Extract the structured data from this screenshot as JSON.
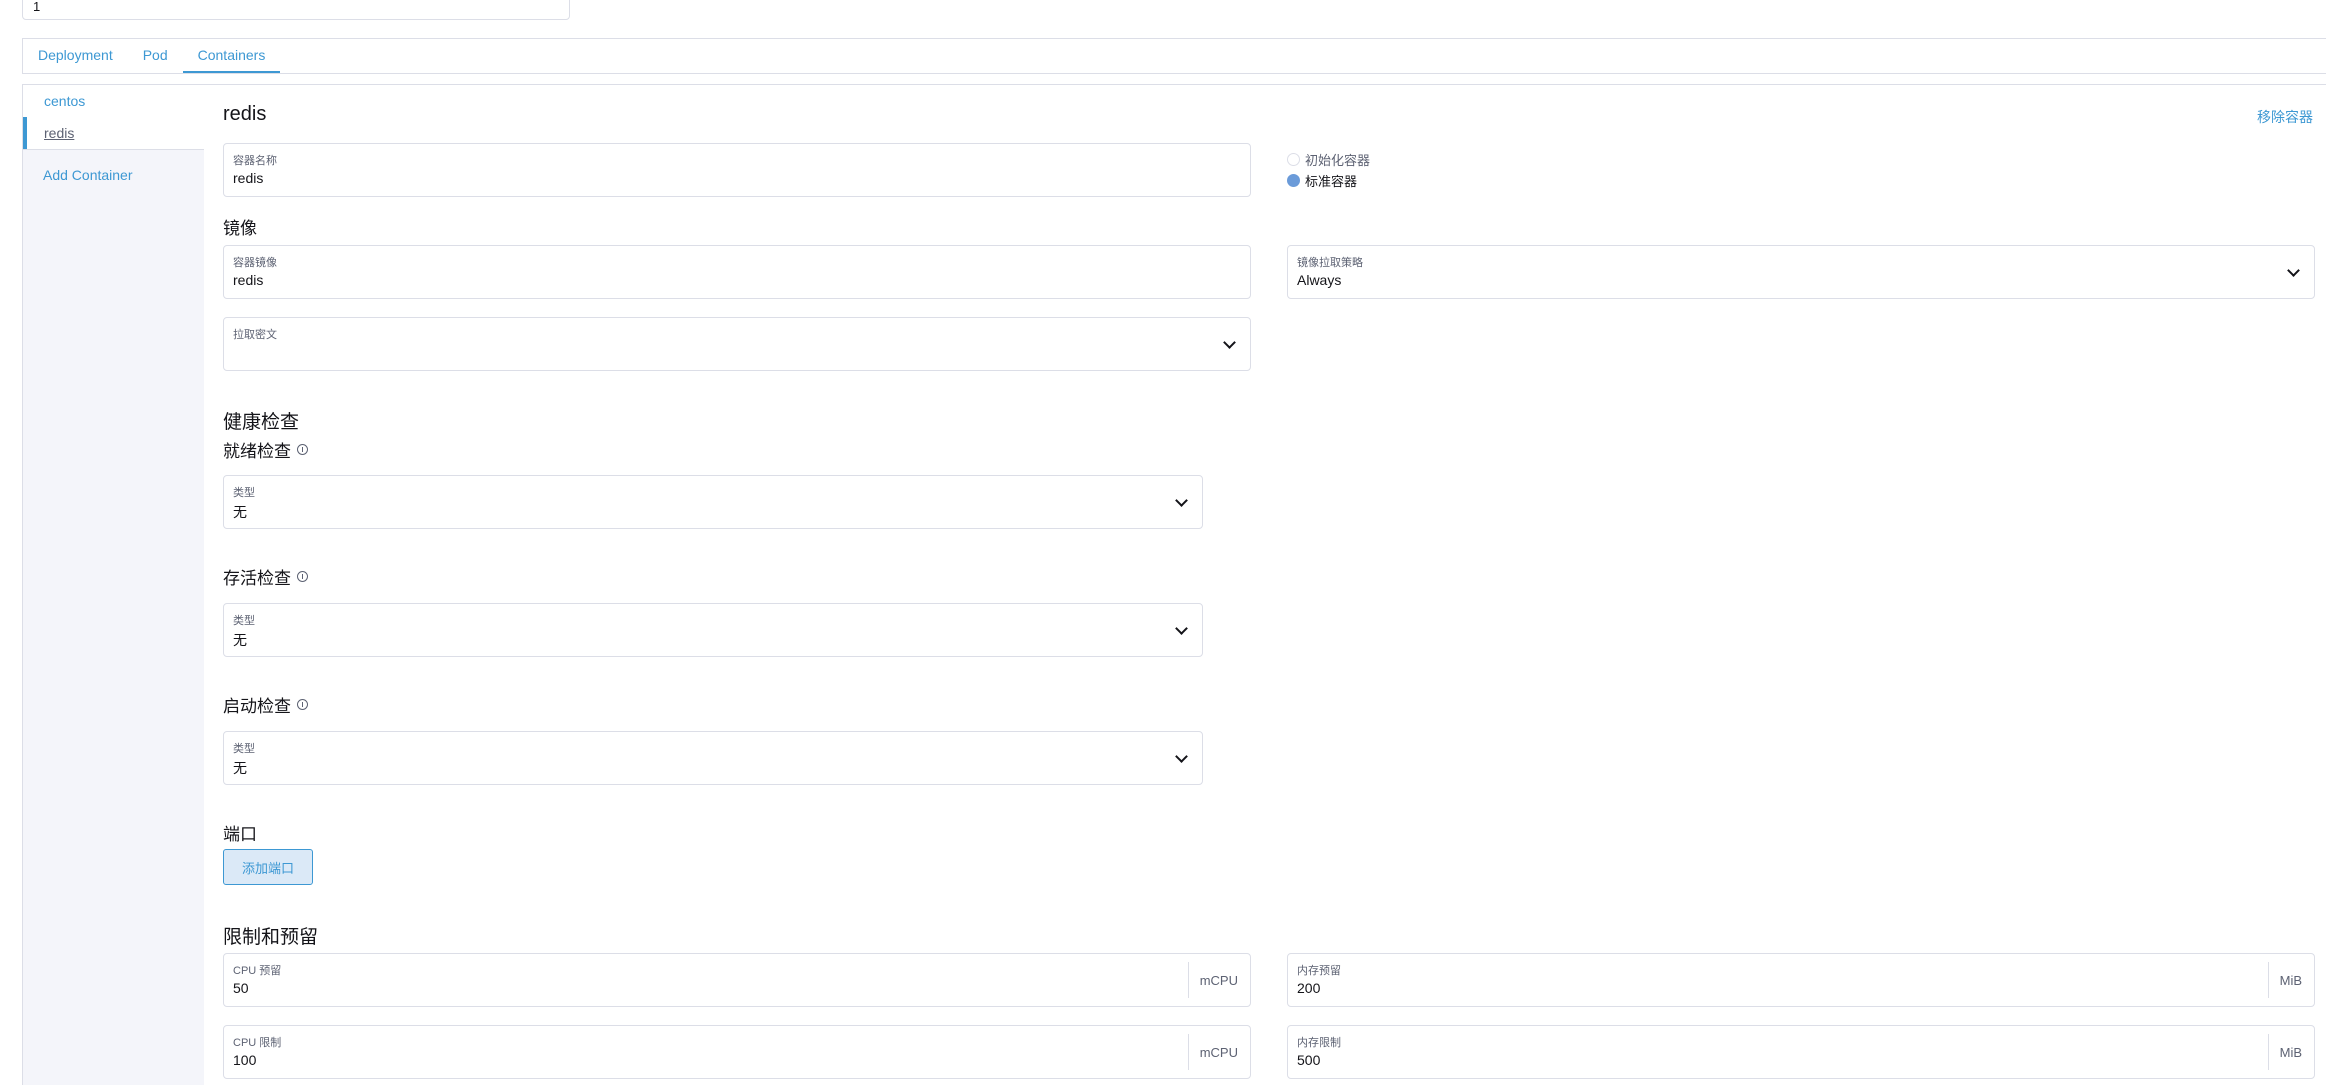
{
  "top_field": {
    "value": "1"
  },
  "tabs": [
    {
      "label": "Deployment"
    },
    {
      "label": "Pod"
    },
    {
      "label": "Containers"
    }
  ],
  "sidebar": {
    "items": [
      {
        "label": "centos"
      },
      {
        "label": "redis"
      }
    ],
    "add_label": "Add Container"
  },
  "container": {
    "title": "redis",
    "remove_label": "移除容器",
    "name_label": "容器名称",
    "name_value": "redis",
    "type_options": [
      {
        "label": "初始化容器",
        "checked": false
      },
      {
        "label": "标准容器",
        "checked": true
      }
    ]
  },
  "image": {
    "heading": "镜像",
    "image_label": "容器镜像",
    "image_value": "redis",
    "pull_policy_label": "镜像拉取策略",
    "pull_policy_value": "Always",
    "pull_secret_label": "拉取密文",
    "pull_secret_value": ""
  },
  "health": {
    "heading": "健康检查",
    "readiness": {
      "heading": "就绪检查",
      "type_label": "类型",
      "type_value": "无"
    },
    "liveness": {
      "heading": "存活检查",
      "type_label": "类型",
      "type_value": "无"
    },
    "startup": {
      "heading": "启动检查",
      "type_label": "类型",
      "type_value": "无"
    }
  },
  "ports": {
    "heading": "端口",
    "add_label": "添加端口"
  },
  "resources": {
    "heading": "限制和预留",
    "cpu_reserve": {
      "label": "CPU 预留",
      "value": "50",
      "unit": "mCPU"
    },
    "mem_reserve": {
      "label": "内存预留",
      "value": "200",
      "unit": "MiB"
    },
    "cpu_limit": {
      "label": "CPU 限制",
      "value": "100",
      "unit": "mCPU"
    },
    "mem_limit": {
      "label": "内存限制",
      "value": "500",
      "unit": "MiB"
    }
  },
  "colors": {
    "accent": "#3d98d3",
    "border": "#dcdee7",
    "sidebar_bg": "#f4f5fa",
    "radio_checked": "#6b9bd9"
  }
}
